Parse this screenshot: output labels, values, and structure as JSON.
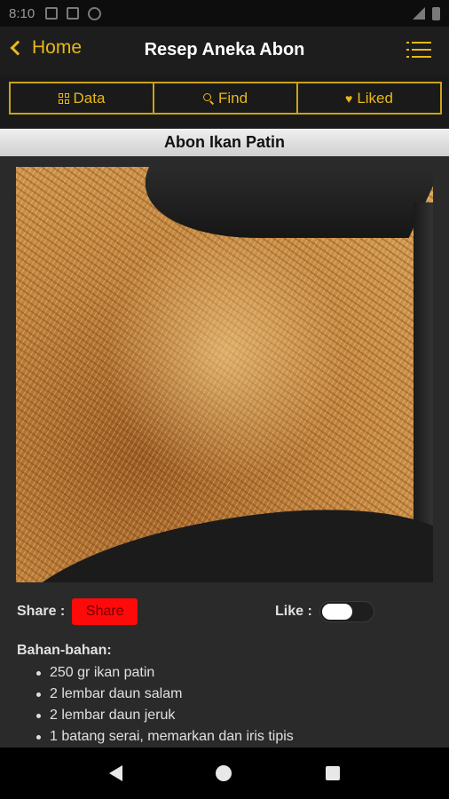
{
  "status_bar": {
    "time": "8:10"
  },
  "app_bar": {
    "back_label": "Home",
    "title": "Resep Aneka Abon",
    "accent_color": "#e8b818"
  },
  "tabs": [
    {
      "label": "Data",
      "icon": "grid-icon"
    },
    {
      "label": "Find",
      "icon": "search-icon"
    },
    {
      "label": "Liked",
      "icon": "heart-icon"
    }
  ],
  "recipe": {
    "title": "Abon Ikan Patin",
    "share_label": "Share :",
    "share_button": "Share",
    "like_label": "Like :",
    "liked": false,
    "ingredients_heading": "Bahan-bahan:",
    "ingredients": [
      "250 gr ikan patin",
      "2 lembar daun salam",
      "2 lembar daun jeruk",
      "1 batang serai, memarkan dan iris tipis"
    ]
  }
}
